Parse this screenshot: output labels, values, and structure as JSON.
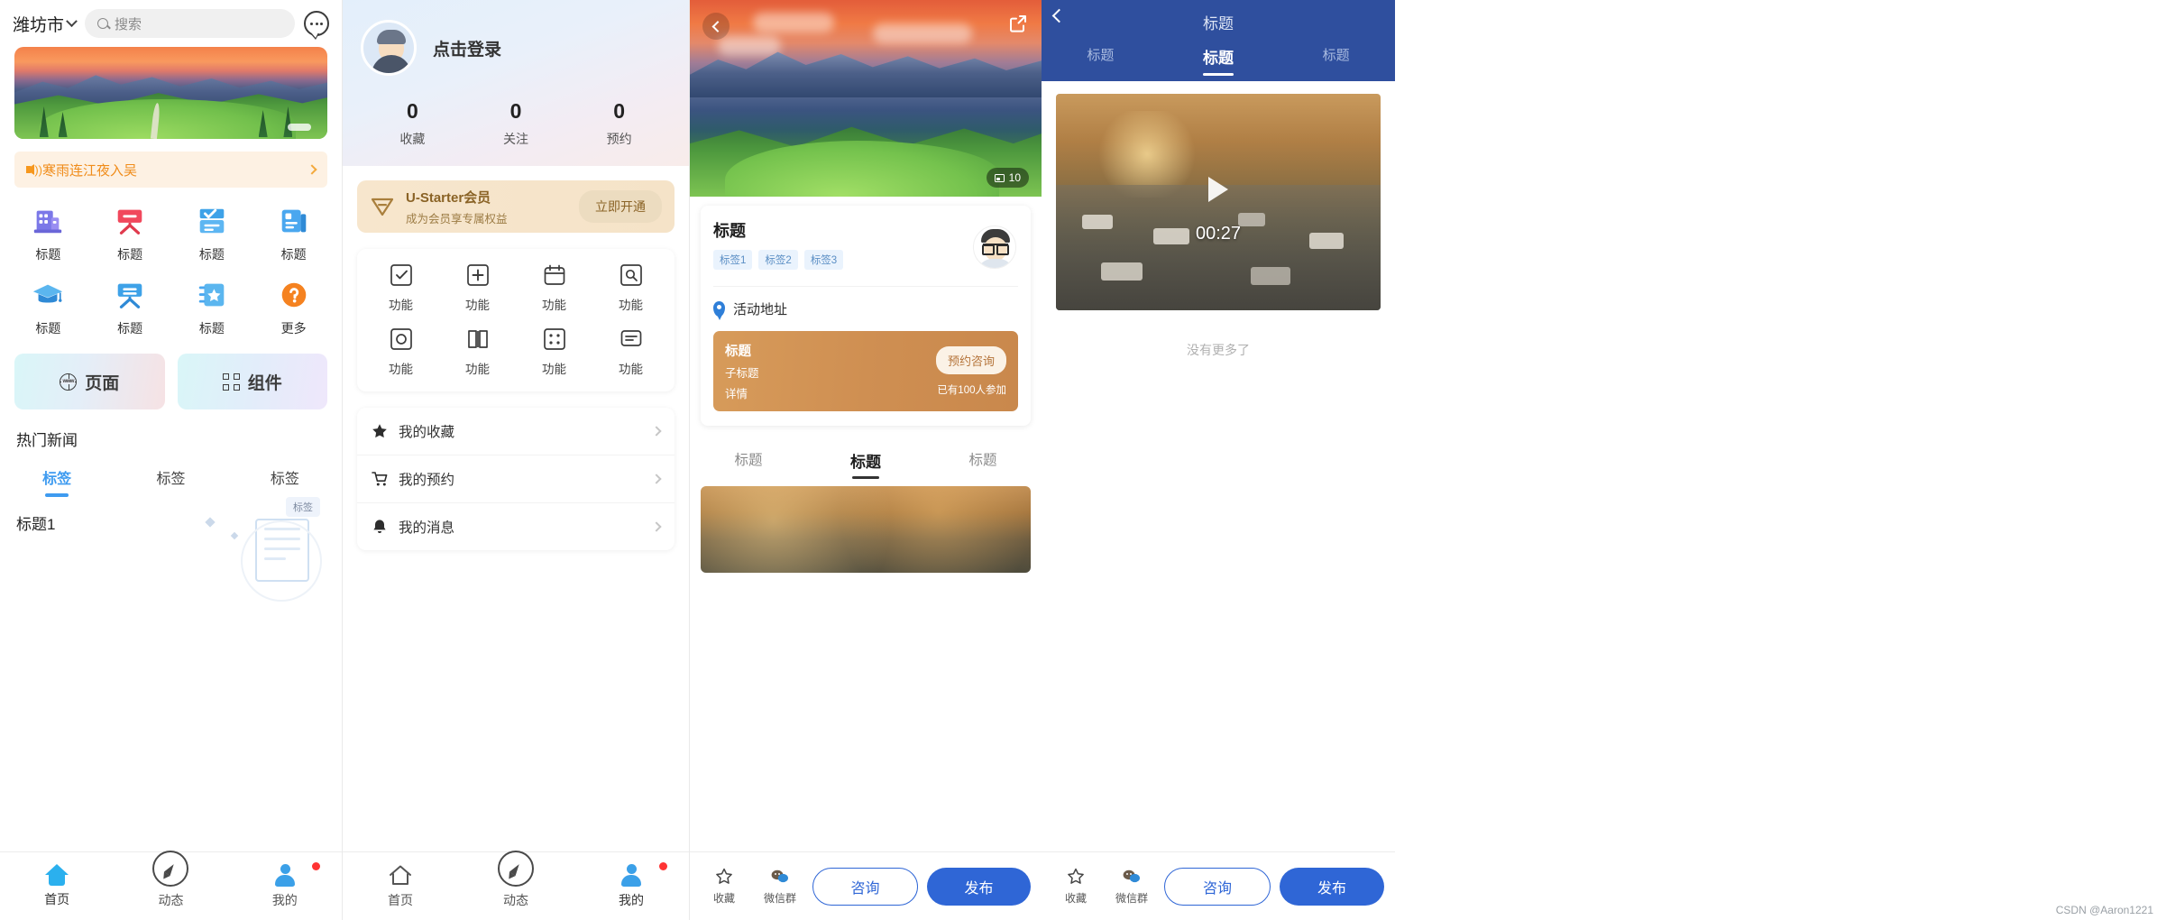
{
  "panel1": {
    "header": {
      "city": "潍坊市",
      "search_placeholder": "搜索",
      "chat_icon": "chat-bubble-icon",
      "chevron": "chevron-down-icon"
    },
    "notice": {
      "text": "寒雨连江夜入吴",
      "icon": "speaker-icon",
      "arrow": "chevron-right-icon"
    },
    "grid": [
      {
        "label": "标题",
        "icon": "building-icon"
      },
      {
        "label": "标题",
        "icon": "easel-icon-red"
      },
      {
        "label": "标题",
        "icon": "checkbox-calendar-icon"
      },
      {
        "label": "标题",
        "icon": "id-card-icon"
      },
      {
        "label": "标题",
        "icon": "graduation-cap-icon"
      },
      {
        "label": "标题",
        "icon": "easel-icon-blue"
      },
      {
        "label": "标题",
        "icon": "star-ticket-icon"
      },
      {
        "label": "更多",
        "icon": "question-mark-icon"
      }
    ],
    "buttons": [
      {
        "label": "页面",
        "icon": "globe-www-icon"
      },
      {
        "label": "组件",
        "icon": "components-icon"
      }
    ],
    "section_title": "热门新闻",
    "tabs": [
      {
        "label": "标签",
        "active": true
      },
      {
        "label": "标签",
        "active": false
      },
      {
        "label": "标签",
        "active": false
      }
    ],
    "article": {
      "title": "标题1",
      "badge": "标签"
    },
    "tabbar": [
      {
        "label": "首页",
        "icon": "home-icon",
        "active": true,
        "dot": false
      },
      {
        "label": "动态",
        "icon": "compass-icon",
        "active": false,
        "dot": false
      },
      {
        "label": "我的",
        "icon": "user-icon",
        "active": false,
        "dot": true
      }
    ]
  },
  "panel2": {
    "login_text": "点击登录",
    "avatar": "user-avatar",
    "stats": [
      {
        "value": "0",
        "label": "收藏"
      },
      {
        "value": "0",
        "label": "关注"
      },
      {
        "value": "0",
        "label": "预约"
      }
    ],
    "vip": {
      "title": "U-Starter会员",
      "subtitle": "成为会员享专属权益",
      "button": "立即开通",
      "icon": "diamond-icon"
    },
    "functions": [
      {
        "label": "功能",
        "icon": "check-square-icon"
      },
      {
        "label": "功能",
        "icon": "plus-square-icon"
      },
      {
        "label": "功能",
        "icon": "calendar-icon"
      },
      {
        "label": "功能",
        "icon": "search-square-icon"
      },
      {
        "label": "功能",
        "icon": "circle-square-icon"
      },
      {
        "label": "功能",
        "icon": "book-icon"
      },
      {
        "label": "功能",
        "icon": "dots-square-icon"
      },
      {
        "label": "功能",
        "icon": "message-icon"
      }
    ],
    "menu": [
      {
        "label": "我的收藏",
        "icon": "star-icon"
      },
      {
        "label": "我的预约",
        "icon": "cart-icon"
      },
      {
        "label": "我的消息",
        "icon": "bell-icon"
      }
    ],
    "tabbar": [
      {
        "label": "首页",
        "icon": "home-outline-icon",
        "active": false,
        "dot": false
      },
      {
        "label": "动态",
        "icon": "compass-icon",
        "active": false,
        "dot": false
      },
      {
        "label": "我的",
        "icon": "user-icon",
        "active": true,
        "dot": true
      }
    ]
  },
  "panel3": {
    "hero": {
      "back": "back-arrow-icon",
      "share": "share-icon",
      "photo_count": "10",
      "photo_icon": "photo-icon"
    },
    "card": {
      "title": "标题",
      "tags": [
        "标签1",
        "标签2",
        "标签3"
      ],
      "avatar": "organizer-avatar",
      "location": {
        "label": "活动地址",
        "icon": "location-pin-icon",
        "arrow": "chevron-right-icon"
      },
      "promo": {
        "title": "标题",
        "subtitle": "子标题",
        "detail": "详情",
        "button": "预约咨询",
        "participants": "已有100人参加"
      }
    },
    "tabs": [
      {
        "label": "标题",
        "active": false
      },
      {
        "label": "标题",
        "active": true
      },
      {
        "label": "标题",
        "active": false
      }
    ],
    "bottom": {
      "collect": {
        "label": "收藏",
        "icon": "star-outline-icon"
      },
      "group": {
        "label": "微信群",
        "icon": "group-icon"
      },
      "consult": "咨询",
      "publish": "发布"
    }
  },
  "panel4": {
    "header": {
      "back": "back-arrow-icon",
      "title": "标题"
    },
    "tabs": [
      {
        "label": "标题",
        "active": false
      },
      {
        "label": "标题",
        "active": true
      },
      {
        "label": "标题",
        "active": false
      }
    ],
    "video": {
      "duration": "00:27",
      "play_icon": "play-icon"
    },
    "no_more": "没有更多了",
    "bottom": {
      "collect": {
        "label": "收藏",
        "icon": "star-outline-icon"
      },
      "group": {
        "label": "微信群",
        "icon": "group-icon"
      },
      "consult": "咨询",
      "publish": "发布"
    }
  },
  "watermark": "CSDN @Aaron1221",
  "colors": {
    "primary_blue": "#3e9bf0",
    "nav_blue": "#2f4f9e",
    "button_blue": "#2f66d6",
    "orange": "#f08c1a",
    "gold": "#8a6326",
    "promo_brown": "#cf8f52"
  }
}
